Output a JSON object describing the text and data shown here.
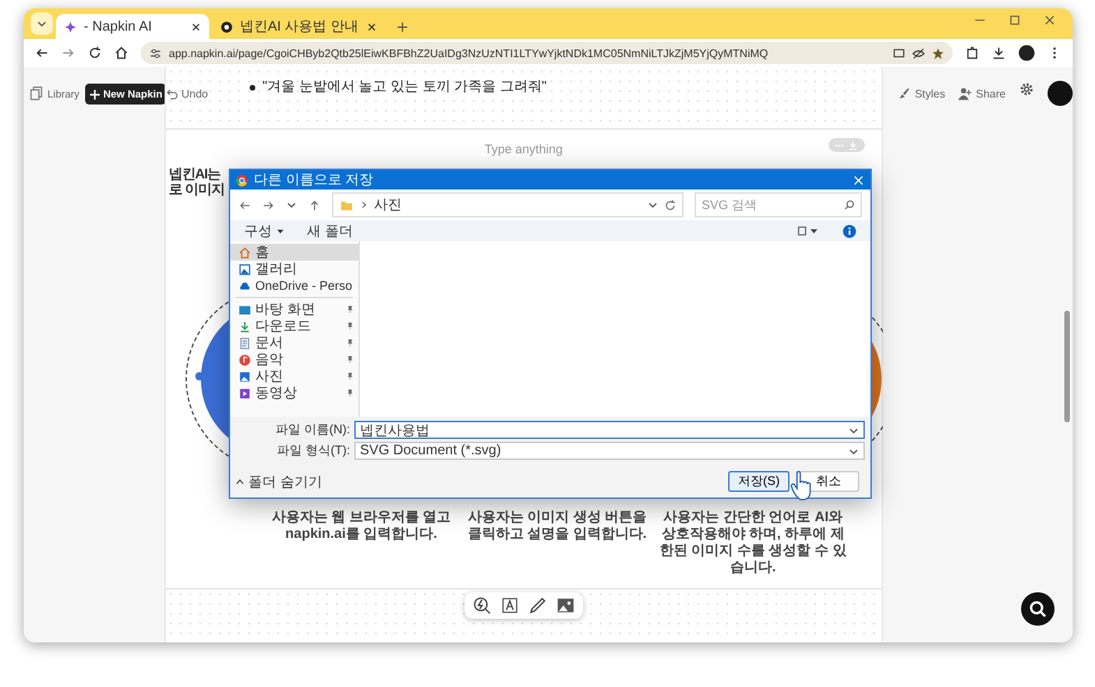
{
  "browser": {
    "tabs": [
      {
        "title": "- Napkin AI",
        "selected": true
      },
      {
        "title": "넵킨AI 사용법 안내",
        "selected": false
      }
    ],
    "url": "app.napkin.ai/page/CgoiCHByb2Qtb25lEiwKBFBhZ2UaIDg3NzUzNTI1LTYwYjktNDk1MC05NmNiLTJkZjM5YjQyMTNiMQ"
  },
  "app_bar": {
    "library": "Library",
    "new_napkin": "New Napkin",
    "undo": "Undo",
    "styles": "Styles",
    "share": "Share"
  },
  "document": {
    "bullets": [
      "\"겨울 눈밭에서 놀고 있는 토끼 가족을 그려줘\""
    ],
    "placeholder": "Type anything",
    "left_fragments": [
      "넵킨AI는",
      "로 이미지"
    ],
    "captions": [
      "사용자는 웹 브라우저를 열고 napkin.ai를 입력합니다.",
      "사용자는 이미지 생성 버튼을 클릭하고 설명을 입력합니다.",
      "사용자는 간단한 언어로 AI와 상호작용해야 하며, 하루에 제한된 이미지 수를 생성할 수 있습니다."
    ]
  },
  "dialog": {
    "title": "다른 이름으로 저장",
    "path": "사진",
    "search_placeholder": "SVG 검색",
    "organize": "구성",
    "new_folder": "새 폴더",
    "nav": [
      {
        "label": "홈",
        "kind": "home",
        "selected": true,
        "pinned": false
      },
      {
        "label": "갤러리",
        "kind": "gallery",
        "selected": false,
        "pinned": false
      },
      {
        "label": "OneDrive - Perso",
        "kind": "cloud",
        "selected": false,
        "pinned": false
      },
      {
        "label": "바탕 화면",
        "kind": "desktop",
        "selected": false,
        "pinned": true
      },
      {
        "label": "다운로드",
        "kind": "download",
        "selected": false,
        "pinned": true
      },
      {
        "label": "문서",
        "kind": "documents",
        "selected": false,
        "pinned": true
      },
      {
        "label": "음악",
        "kind": "music",
        "selected": false,
        "pinned": true
      },
      {
        "label": "사진",
        "kind": "pictures",
        "selected": false,
        "pinned": true
      },
      {
        "label": "동영상",
        "kind": "videos",
        "selected": false,
        "pinned": true
      }
    ],
    "file_name_label": "파일 이름(N):",
    "file_name": "넵킨사용법",
    "file_type_label": "파일 형식(T):",
    "file_type": "SVG Document (*.svg)",
    "hide_folders": "폴더 숨기기",
    "save": "저장(S)",
    "cancel": "취소"
  }
}
